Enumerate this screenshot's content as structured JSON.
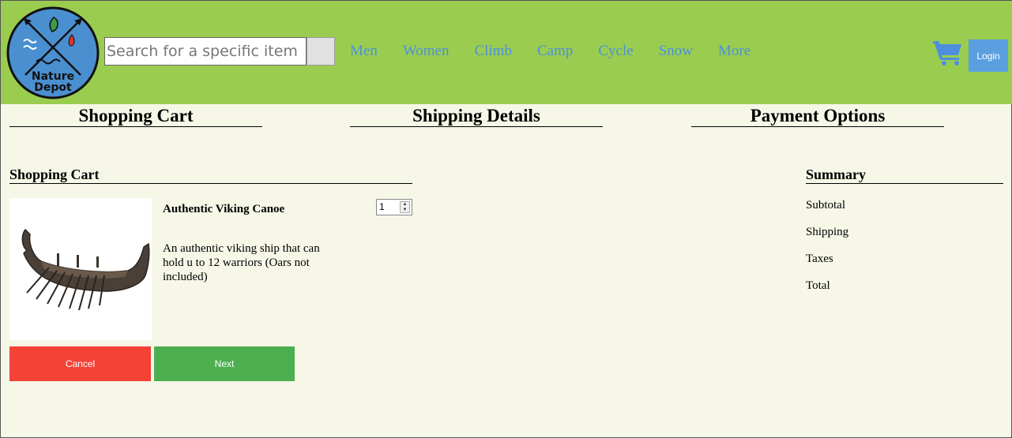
{
  "header": {
    "logo_text_line1": "Nature",
    "logo_text_line2": "Depot",
    "search_placeholder": "Search for a specific item",
    "nav": [
      "Men",
      "Women",
      "Climb",
      "Camp",
      "Cycle",
      "Snow",
      "More"
    ],
    "login_label": "Login",
    "icons": {
      "cart": "shopping-cart-icon"
    },
    "colors": {
      "header_bg": "#9acd4f",
      "nav_link": "#4d8fdd",
      "login_bg": "#5aa0e0"
    }
  },
  "steps": [
    "Shopping Cart",
    "Shipping Details",
    "Payment Options"
  ],
  "cart": {
    "title": "Shopping Cart",
    "item": {
      "name": "Authentic Viking Canoe",
      "description": "An authentic viking ship that can hold u to 12 warriors (Oars not included)",
      "quantity": "1"
    },
    "cancel_label": "Cancel",
    "next_label": "Next",
    "colors": {
      "cancel": "#f44336",
      "next": "#4caf50"
    }
  },
  "summary": {
    "title": "Summary",
    "rows": [
      "Subtotal",
      "Shipping",
      "Taxes",
      "Total"
    ]
  }
}
